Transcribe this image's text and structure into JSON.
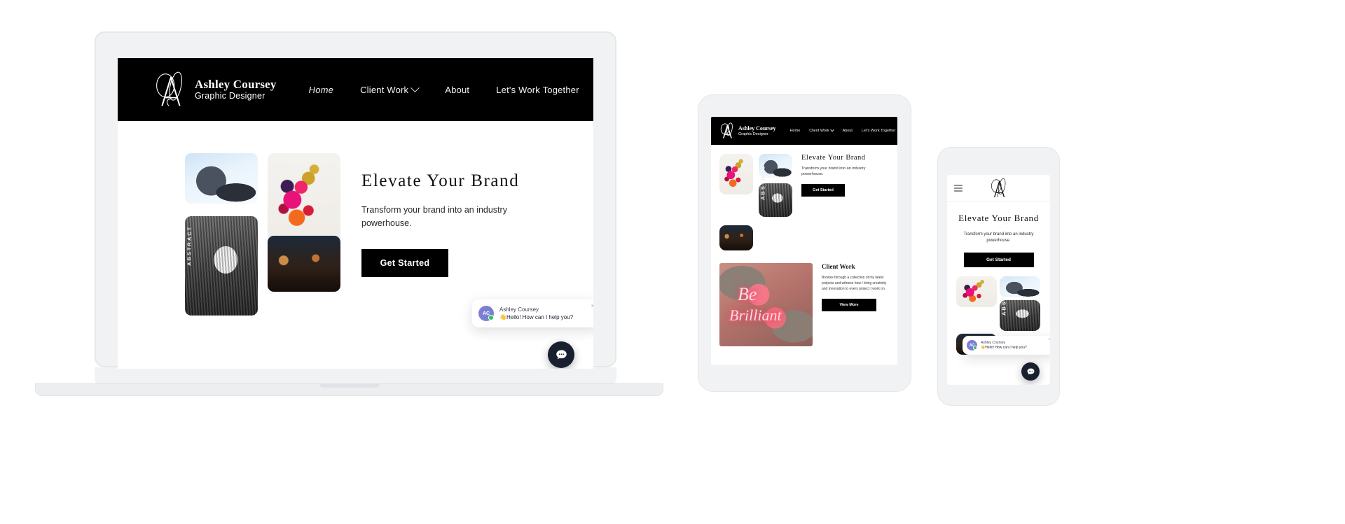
{
  "brand": {
    "name": "Ashley Coursey",
    "tagline": "Graphic Designer",
    "monogram": "A",
    "accent_dark": "#000000",
    "chat_avatar_color": "#7b7fd4",
    "online_dot_color": "#22c55e",
    "fab_color": "#18202f"
  },
  "nav": {
    "items": [
      {
        "label": "Home",
        "active": true,
        "has_caret": false
      },
      {
        "label": "Client Work",
        "active": false,
        "has_caret": true
      },
      {
        "label": "About",
        "active": false,
        "has_caret": false
      },
      {
        "label": "Let's Work Together",
        "active": false,
        "has_caret": false
      }
    ]
  },
  "hero": {
    "title": "Elevate Your Brand",
    "subtitle": "Transform your brand into an industry powerhouse.",
    "cta": "Get Started",
    "images": [
      {
        "name": "snowboard-photo",
        "alt": "Snowboard against blue sky"
      },
      {
        "name": "paint-splatter-photo",
        "alt": "Pink and gold paint splatter"
      },
      {
        "name": "abstract-poster-photo",
        "alt": "Black and white ABSTRACT poster",
        "caption": "ABSTRACT"
      },
      {
        "name": "restaurant-interior-photo",
        "alt": "Warm lit restaurant interior"
      }
    ]
  },
  "client_work": {
    "title": "Client Work",
    "body": "Browse through a collection of my latest projects and witness how I bring creativity and innovation to every project I work on.",
    "cta": "View More",
    "feature_image": {
      "name": "be-brilliant-neon",
      "line1": "Be",
      "line2": "Brilliant"
    }
  },
  "chat": {
    "avatar_initials": "AC",
    "name": "Ashley Coursey",
    "message": "👋Hello! How can I help you?",
    "close_label": "×",
    "fab_icon": "chat-bubble-icon"
  },
  "devices": [
    {
      "name": "laptop"
    },
    {
      "name": "tablet"
    },
    {
      "name": "phone"
    }
  ]
}
